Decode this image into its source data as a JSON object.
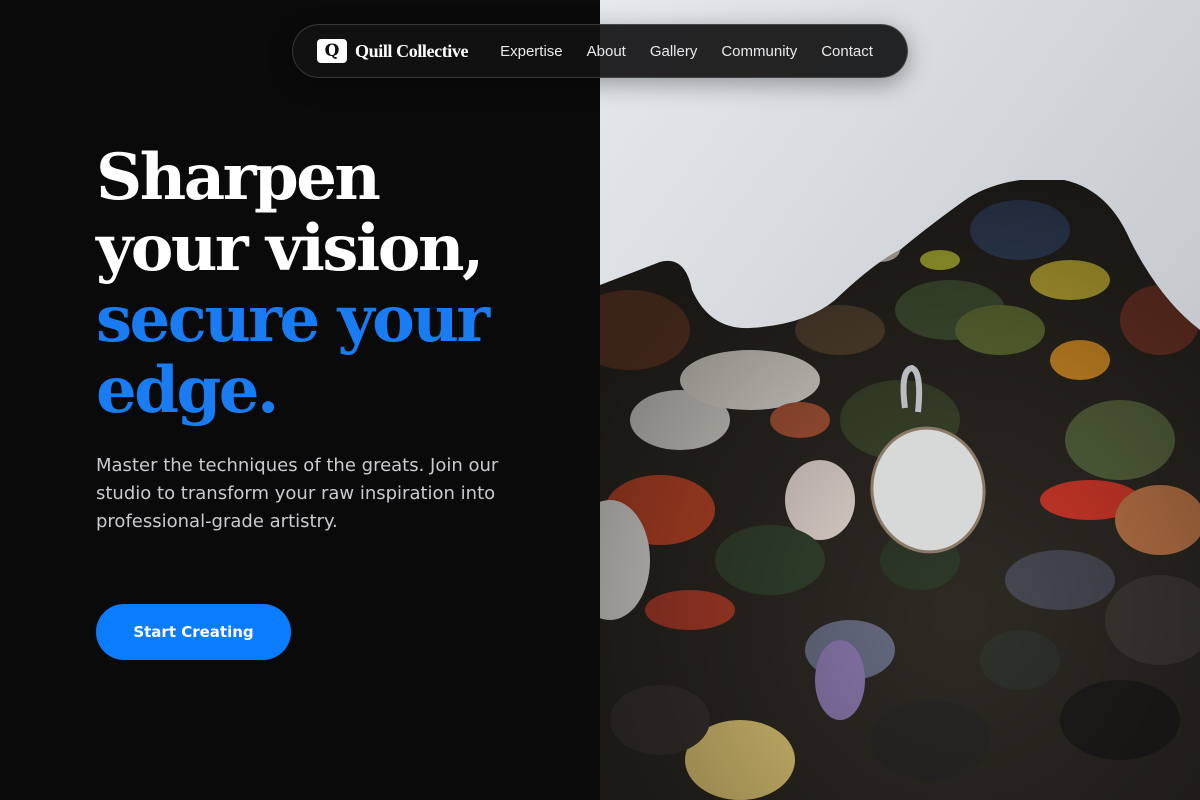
{
  "nav": {
    "logo_letter": "Q",
    "brand": "Quill Collective",
    "links": [
      "Expertise",
      "About",
      "Gallery",
      "Community",
      "Contact"
    ]
  },
  "hero": {
    "heading_white": [
      "Sharpen",
      "your vision,"
    ],
    "heading_accent": [
      "secure your",
      "edge."
    ],
    "subtext": "Master the techniques of the greats. Join our studio to transform your raw inspiration into professional-grade artistry.",
    "cta_label": "Start Creating"
  },
  "image": {
    "subject": "paint-palette-photo"
  },
  "colors": {
    "background": "#0a0a0b",
    "accent": "#1a7cf2",
    "cta": "#0a7cff",
    "text": "#ffffff"
  }
}
